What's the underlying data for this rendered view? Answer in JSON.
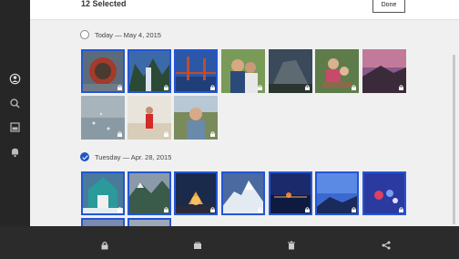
{
  "header": {
    "selected_count": "12 Selected",
    "done_label": "Done"
  },
  "sections": [
    {
      "label": "Today — May 4, 2015",
      "checked": false
    },
    {
      "label": "Tuesday — Apr. 28, 2015",
      "checked": true
    }
  ],
  "sidebar": {
    "icons": [
      "account-icon",
      "search-icon",
      "library-icon",
      "notifications-icon",
      "camera-icon"
    ]
  },
  "bottombar": {
    "icons": [
      "lock-icon",
      "album-icon",
      "trash-icon",
      "share-icon"
    ]
  },
  "colors": {
    "accent": "#2456d4",
    "sidebar": "#262626",
    "bottombar": "#2b2b2b"
  }
}
